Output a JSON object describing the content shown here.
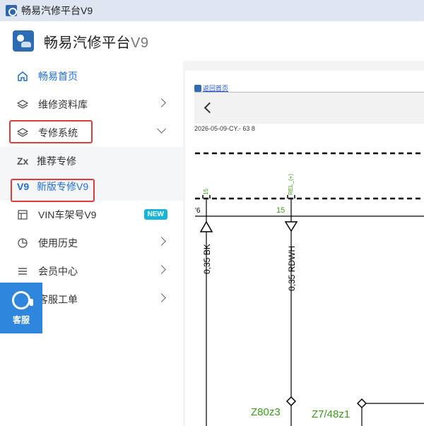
{
  "window": {
    "title": "畅易汽修平台V9"
  },
  "header": {
    "brand": "畅易汽修平台",
    "version": "V9"
  },
  "sidebar": {
    "items": [
      {
        "label": "畅易首页",
        "icon": "home-icon"
      },
      {
        "label": "维修资料库",
        "icon": "layers-icon"
      },
      {
        "label": "专修系统",
        "icon": "layers-icon"
      },
      {
        "label": "VIN车架号V9",
        "icon": "card-icon",
        "badge": "NEW"
      },
      {
        "label": "使用历史",
        "icon": "history-icon"
      },
      {
        "label": "会员中心",
        "icon": "menu-icon"
      },
      {
        "label": "客服工单",
        "icon": "ticket-icon"
      }
    ],
    "sub_items": [
      {
        "prefix": "Zx",
        "label": "推荐专修"
      },
      {
        "prefix": "V9",
        "label": "新版专修V9"
      }
    ],
    "kefu": "客服"
  },
  "content": {
    "home_link": "返回首页",
    "doc_id": "2026-05-09-CY.- 63 8",
    "schematic": {
      "top_label_1": "15",
      "top_label_2": "REL_(+)",
      "left_edge": "'6",
      "pin_label": "15",
      "wire_1": "0,35 BK",
      "wire_2": "0,35 RDWH",
      "node_1": "Z80z3",
      "node_2": "Z7/48z1"
    }
  },
  "colors": {
    "accent": "#1f6fd1",
    "highlight": "#e03b3b",
    "schematic_green": "#3c9b1c",
    "kefu_bg": "#2f86dd",
    "badge": "#19b5d5"
  }
}
